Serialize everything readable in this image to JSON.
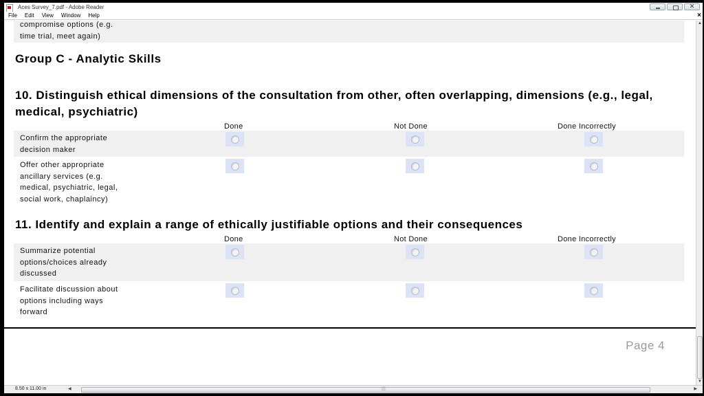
{
  "window": {
    "title": "Aces Survey_7.pdf - Adobe Reader"
  },
  "menu": [
    "File",
    "Edit",
    "View",
    "Window",
    "Help"
  ],
  "close_doc_label": "×",
  "document": {
    "previous_text": "compromise options (e.g.\ntime trial, meet again)",
    "group_heading": "Group C - Analytic Skills",
    "columns": [
      "Done",
      "Not Done",
      "Done Incorrectly"
    ],
    "questions": [
      {
        "title": "10. Distinguish ethical dimensions of the consultation from other, often overlapping, dimensions (e.g., legal, medical, psychiatric)",
        "items": [
          "Confirm the appropriate\ndecision maker",
          "Offer other appropriate\nancillary services (e.g.\nmedical, psychiatric, legal,\nsocial work, chaplaincy)"
        ]
      },
      {
        "title": "11. Identify and explain a range of ethically justifiable options and their consequences",
        "items": [
          "Summarize potential\noptions/choices already\ndiscussed",
          "Facilitate discussion about\noptions including ways\nforward"
        ]
      }
    ],
    "page_label": "Page 4"
  },
  "status": {
    "page_size": "8.50 x 11.00 in"
  },
  "colors": {
    "radio_field_bg": "#dde3f6",
    "row_shade": "#f0f0f0",
    "page_label": "#9a9a9a"
  }
}
